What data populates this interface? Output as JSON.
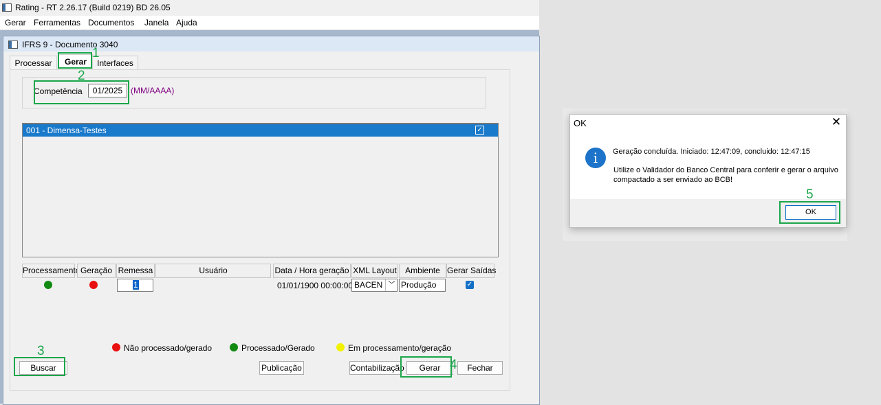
{
  "app": {
    "title": "Rating - RT 2.26.17 (Build 0219) BD 26.05",
    "menu": [
      "Gerar",
      "Ferramentas",
      "Documentos",
      "Janela",
      "Ajuda"
    ]
  },
  "child": {
    "title": "IFRS 9 - Documento 3040",
    "tabs": [
      "Processar",
      "Gerar",
      "Interfaces"
    ],
    "active_tab": "Gerar"
  },
  "competencia": {
    "label": "Competência",
    "value": "01/2025",
    "hint": "(MM/AAAA)"
  },
  "list": {
    "items": [
      {
        "label": "001 - Dimensa-Testes",
        "checked": true
      }
    ]
  },
  "grid": {
    "headers": [
      "Processamento",
      "Geração",
      "Remessa",
      "Usuário",
      "Data / Hora geração",
      "XML Layout",
      "Ambiente",
      "Gerar Saídas"
    ],
    "row": {
      "processamento_status": "green",
      "geracao_status": "red",
      "remessa": "1",
      "usuario": "",
      "data_hora": "01/01/1900 00:00:00",
      "xml_layout": "BACEN",
      "ambiente": "Produção",
      "gerar_saidas": true
    }
  },
  "legend": [
    {
      "color": "#e81010",
      "label": "Não processado/gerado"
    },
    {
      "color": "#128a12",
      "label": "Processado/Gerado"
    },
    {
      "color": "#f2f200",
      "label": "Em processamento/geração"
    }
  ],
  "buttons": {
    "buscar": "Buscar",
    "publicacao": "Publicação",
    "contabilizacao": "Contabilização",
    "gerar": "Gerar",
    "fechar": "Fechar"
  },
  "annotations": [
    "1",
    "2",
    "3",
    "4",
    "5"
  ],
  "dialog": {
    "title": "OK",
    "close_glyph": "✕",
    "info_glyph": "i",
    "line1": "Geração concluída. Iniciado: 12:47:09, concluido: 12:47:15",
    "line2": " Utilize o Validador do Banco Central para conferir e gerar o arquivo compactado a ser enviado ao BCB!",
    "ok": "OK"
  },
  "colors": {
    "highlight": "#1aa64a",
    "selection": "#1979ca"
  }
}
